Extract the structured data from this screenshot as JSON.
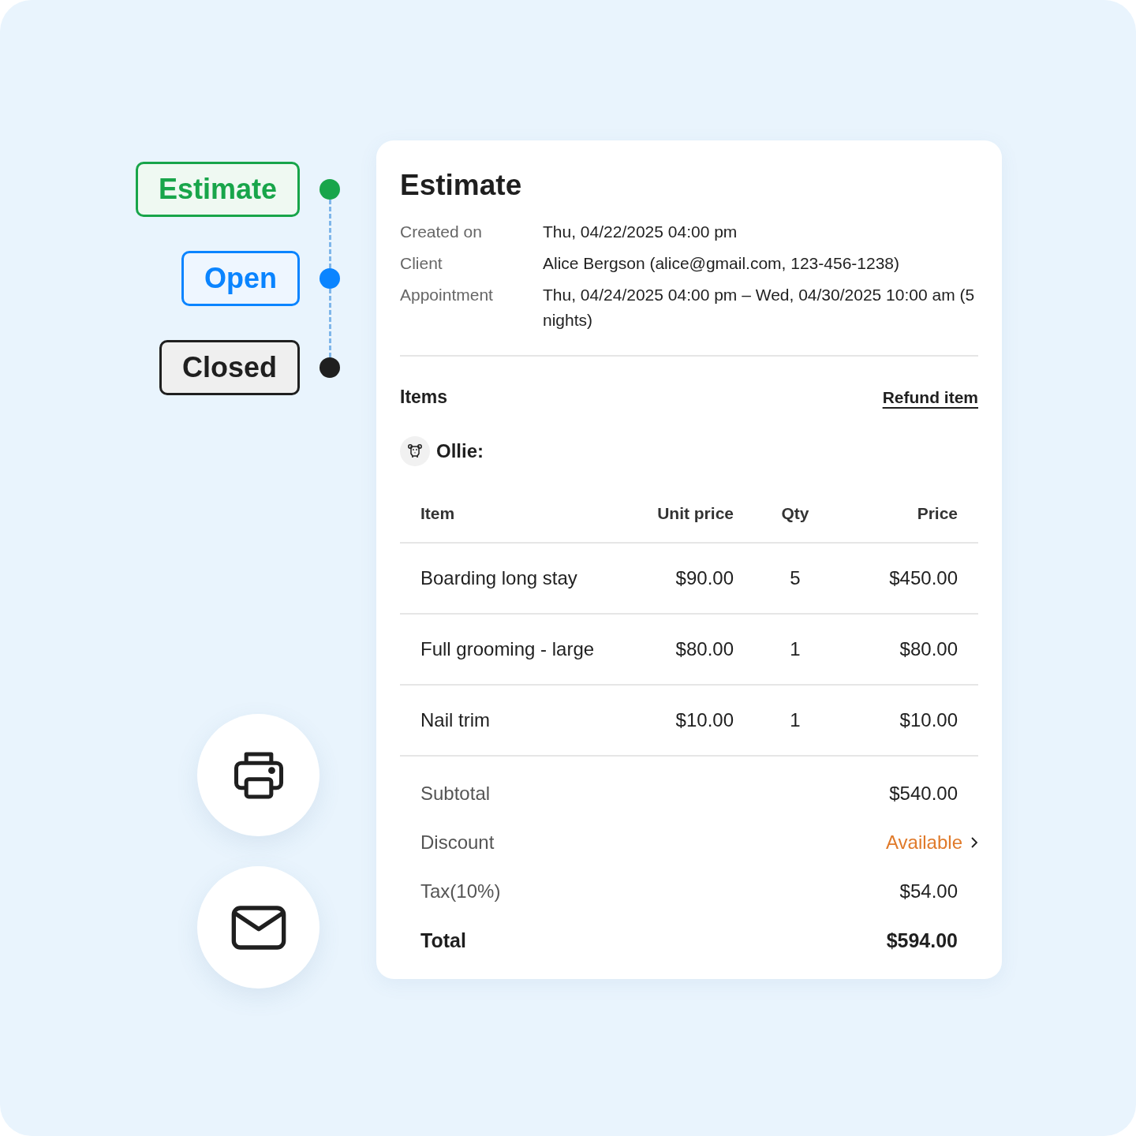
{
  "statuses": [
    {
      "label": "Estimate",
      "color": "#18a54a"
    },
    {
      "label": "Open",
      "color": "#0a84ff"
    },
    {
      "label": "Closed",
      "color": "#1f1f1f"
    }
  ],
  "actions": [
    {
      "kind": "print"
    },
    {
      "kind": "email"
    }
  ],
  "estimate": {
    "title": "Estimate",
    "details": [
      {
        "label": "Created on",
        "value": "Thu, 04/22/2025 04:00 pm"
      },
      {
        "label": "Client",
        "value": "Alice Bergson (alice@gmail.com, 123-456-1238)"
      },
      {
        "label": "Appointment",
        "value": "Thu, 04/24/2025 04:00 pm – Wed, 04/30/2025 10:00 am (5 nights)"
      }
    ],
    "items_heading": "Items",
    "refund_link": "Refund item",
    "pet": {
      "name": "Ollie:"
    },
    "table": {
      "columns": [
        "Item",
        "Unit price",
        "Qty",
        "Price"
      ],
      "rows": [
        [
          "Boarding long stay",
          "$90.00",
          "5",
          "$450.00"
        ],
        [
          "Full grooming - large",
          "$80.00",
          "1",
          "$80.00"
        ],
        [
          "Nail trim",
          "$10.00",
          "1",
          "$10.00"
        ]
      ]
    },
    "summary": [
      {
        "kind": "plain",
        "label": "Subtotal",
        "value": "$540.00"
      },
      {
        "kind": "link",
        "label": "Discount",
        "value": "Available"
      },
      {
        "kind": "plain",
        "label": "Tax(10%)",
        "value": "$54.00"
      },
      {
        "kind": "total",
        "label": "Total",
        "value": "$594.00"
      }
    ]
  }
}
